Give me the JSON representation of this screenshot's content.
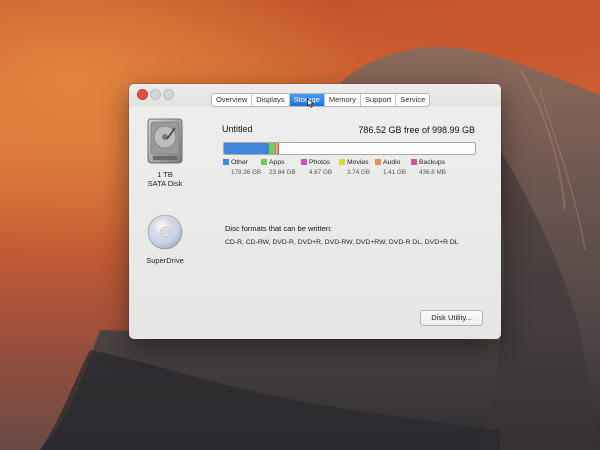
{
  "tabs": [
    {
      "label": "Overview"
    },
    {
      "label": "Displays"
    },
    {
      "label": "Storage"
    },
    {
      "label": "Memory"
    },
    {
      "label": "Support"
    },
    {
      "label": "Service"
    }
  ],
  "active_tab": "Storage",
  "devices": {
    "hdd": {
      "line1": "1 TB",
      "line2": "SATA Disk"
    },
    "dvd": {
      "label": "SuperDrive"
    }
  },
  "volume": {
    "name": "Untitled",
    "free_text": "786.52 GB free of 998.99 GB"
  },
  "usage": [
    {
      "name": "Other",
      "size": "178.36 GB",
      "gb": 178.36,
      "color": "#3f86dd"
    },
    {
      "name": "Apps",
      "size": "23.84 GB",
      "gb": 23.84,
      "color": "#6fcf52"
    },
    {
      "name": "Photos",
      "size": "4.67 GB",
      "gb": 4.67,
      "color": "#d94bc9"
    },
    {
      "name": "Movies",
      "size": "3.74 GB",
      "gb": 3.74,
      "color": "#e3d43a"
    },
    {
      "name": "Audio",
      "size": "1.41 GB",
      "gb": 1.41,
      "color": "#ef8c4a"
    },
    {
      "name": "Backups",
      "size": "436.8 MB",
      "gb": 0.4368,
      "color": "#d74f9b"
    }
  ],
  "total_gb": 998.99,
  "disc": {
    "title": "Disc formats that can be written:",
    "formats": "CD-R, CD-RW, DVD-R, DVD+R, DVD-RW, DVD+RW, DVD-R DL, DVD+R DL"
  },
  "buttons": {
    "disk_utility": "Disk Utility..."
  }
}
